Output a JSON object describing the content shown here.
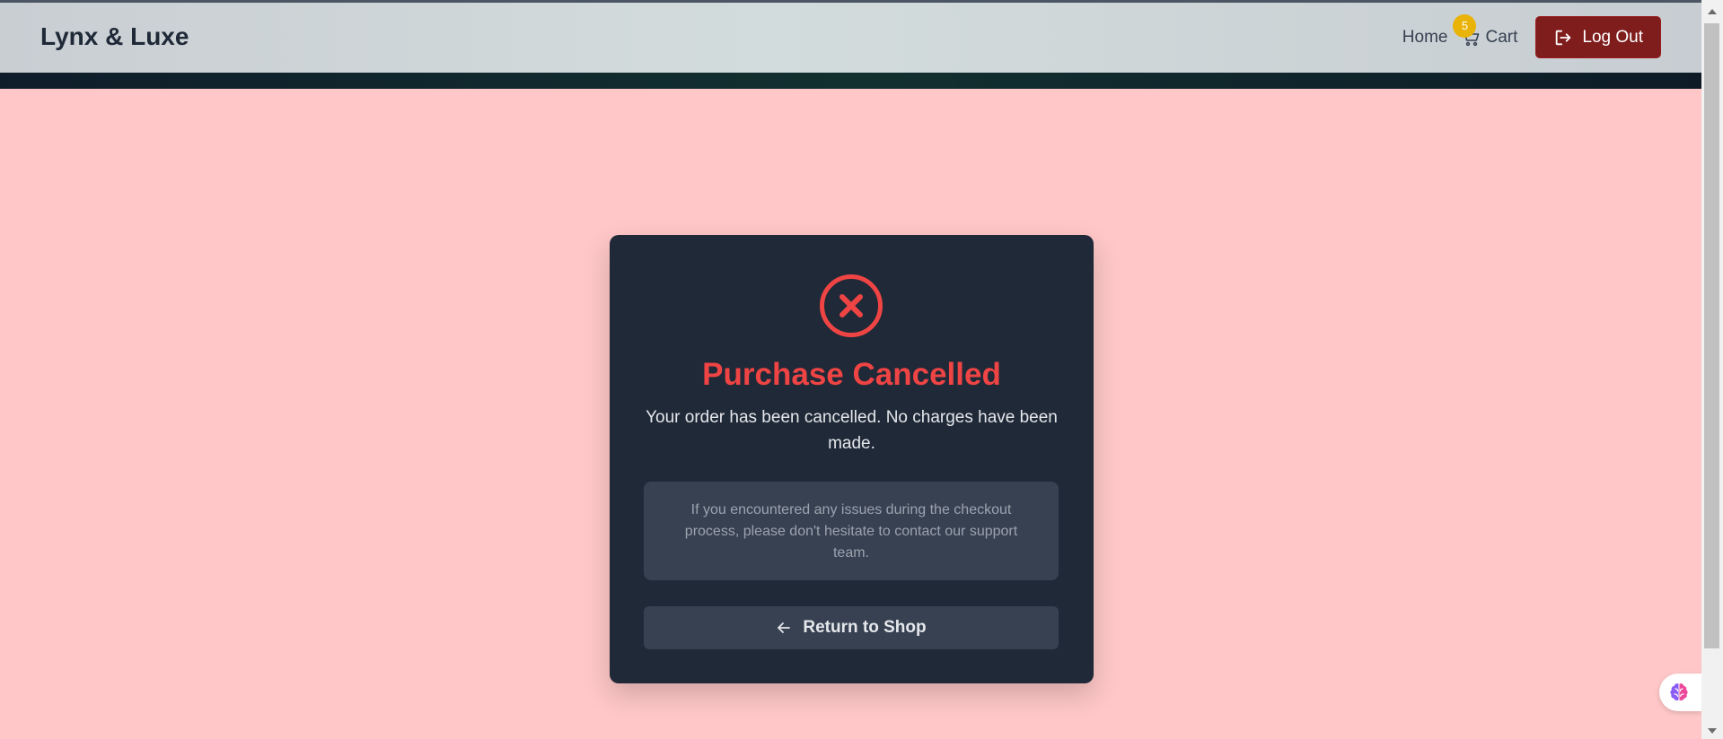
{
  "header": {
    "brand": "Lynx & Luxe",
    "nav": {
      "home_label": "Home",
      "cart_label": "Cart",
      "cart_count": "5",
      "logout_label": "Log Out"
    }
  },
  "main": {
    "status_icon": "x-circle-icon",
    "title": "Purchase Cancelled",
    "message": "Your order has been cancelled. No charges have been made.",
    "info_text": "If you encountered any issues during the checkout process, please don't hesitate to contact our support team.",
    "return_label": "Return to Shop"
  },
  "colors": {
    "page_background": "#ffc7c7",
    "card_background": "#1f2937",
    "accent_red": "#ef4444",
    "logout_background": "#7f1d1d",
    "badge": "#eab308"
  }
}
